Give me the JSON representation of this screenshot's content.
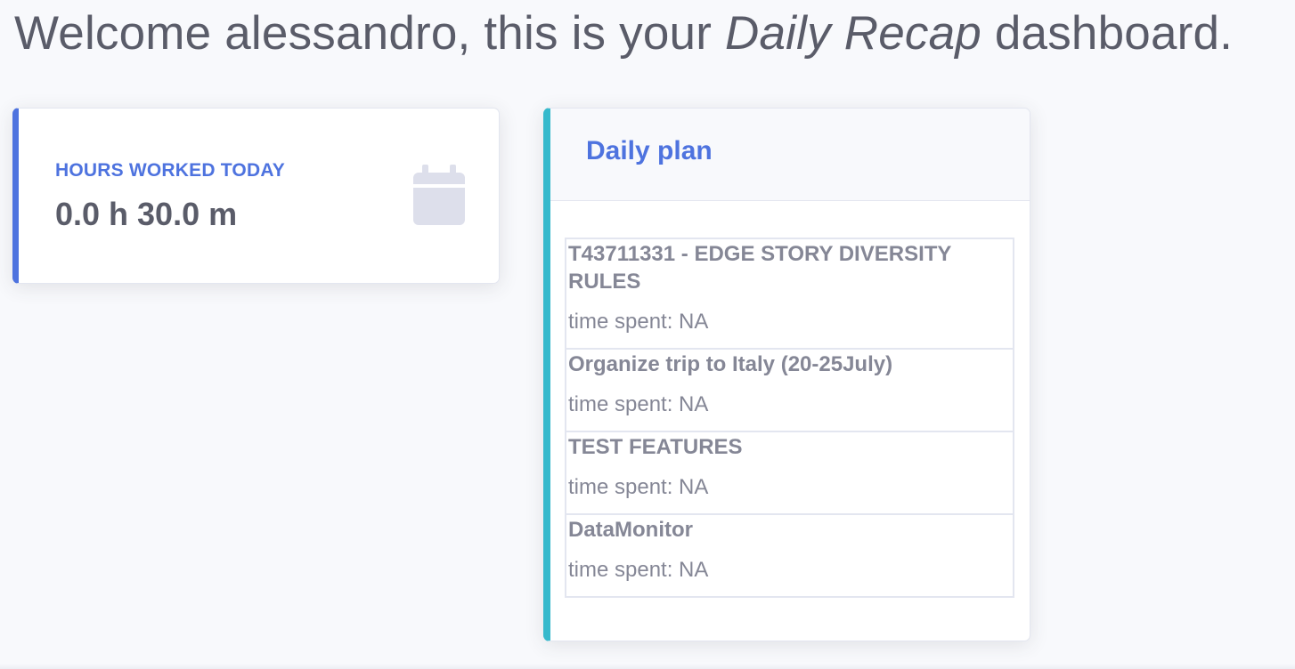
{
  "header": {
    "title_prefix": "Welcome alessandro, this is your ",
    "title_emphasis": "Daily Recap",
    "title_suffix": " dashboard."
  },
  "hours_card": {
    "label": "Hours worked today",
    "value": "0.0 h 30.0 m",
    "icon": "calendar-icon",
    "accent_color": "#4e73df"
  },
  "daily_plan": {
    "title": "Daily plan",
    "accent_color": "#36b9cc",
    "tasks": [
      {
        "name": "T43711331 - EDGE STORY DIVERSITY RULES",
        "time": "time spent: NA"
      },
      {
        "name": "Organize trip to Italy (20-25July)",
        "time": "time spent: NA"
      },
      {
        "name": "TEST FEATURES",
        "time": "time spent: NA"
      },
      {
        "name": "DataMonitor",
        "time": "time spent: NA"
      }
    ]
  }
}
